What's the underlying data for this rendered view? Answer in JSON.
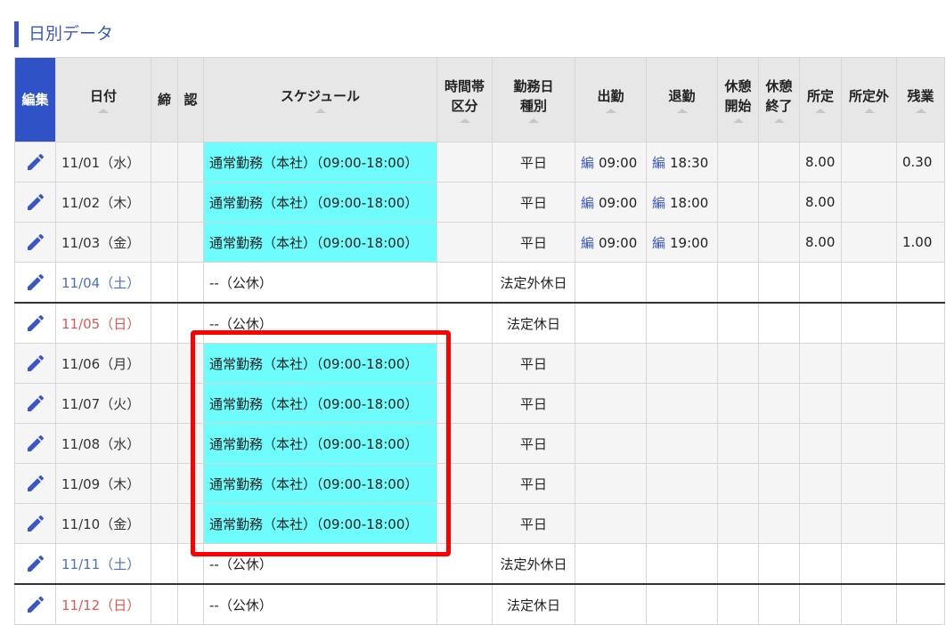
{
  "section_title": "日別データ",
  "headers": {
    "edit": "編集",
    "date": "日付",
    "shime": "締",
    "nin": "認",
    "schedule": "スケジュール",
    "timezone_line1": "時間帯",
    "timezone_line2": "区分",
    "daytype_line1": "勤務日",
    "daytype_line2": "種別",
    "in": "出勤",
    "out": "退勤",
    "break_start_line1": "休憩",
    "break_start_line2": "開始",
    "break_end_line1": "休憩",
    "break_end_line2": "終了",
    "scheduled": "所定",
    "non_scheduled": "所定外",
    "overtime": "残業"
  },
  "hen_label": "編",
  "rows": [
    {
      "date": "11/01（水）",
      "day": "weekday",
      "schedule": "通常勤務（本社）（09:00-18:00）",
      "daytype": "平日",
      "in": "09:00",
      "out": "18:30",
      "scheduled": "8.00",
      "overtime": "0.30"
    },
    {
      "date": "11/02（木）",
      "day": "weekday",
      "schedule": "通常勤務（本社）（09:00-18:00）",
      "daytype": "平日",
      "in": "09:00",
      "out": "18:00",
      "scheduled": "8.00",
      "overtime": ""
    },
    {
      "date": "11/03（金）",
      "day": "weekday",
      "schedule": "通常勤務（本社）（09:00-18:00）",
      "daytype": "平日",
      "in": "09:00",
      "out": "19:00",
      "scheduled": "8.00",
      "overtime": "1.00"
    },
    {
      "date": "11/04（土）",
      "day": "sat",
      "schedule": "--（公休）",
      "daytype": "法定外休日",
      "in": "",
      "out": "",
      "scheduled": "",
      "overtime": ""
    },
    {
      "date": "11/05（日）",
      "day": "sun",
      "schedule": "--（公休）",
      "daytype": "法定休日",
      "in": "",
      "out": "",
      "scheduled": "",
      "overtime": ""
    },
    {
      "date": "11/06（月）",
      "day": "weekday",
      "schedule": "通常勤務（本社）（09:00-18:00）",
      "daytype": "平日",
      "in": "",
      "out": "",
      "scheduled": "",
      "overtime": ""
    },
    {
      "date": "11/07（火）",
      "day": "weekday",
      "schedule": "通常勤務（本社）（09:00-18:00）",
      "daytype": "平日",
      "in": "",
      "out": "",
      "scheduled": "",
      "overtime": ""
    },
    {
      "date": "11/08（水）",
      "day": "weekday",
      "schedule": "通常勤務（本社）（09:00-18:00）",
      "daytype": "平日",
      "in": "",
      "out": "",
      "scheduled": "",
      "overtime": ""
    },
    {
      "date": "11/09（木）",
      "day": "weekday",
      "schedule": "通常勤務（本社）（09:00-18:00）",
      "daytype": "平日",
      "in": "",
      "out": "",
      "scheduled": "",
      "overtime": ""
    },
    {
      "date": "11/10（金）",
      "day": "weekday",
      "schedule": "通常勤務（本社）（09:00-18:00）",
      "daytype": "平日",
      "in": "",
      "out": "",
      "scheduled": "",
      "overtime": ""
    },
    {
      "date": "11/11（土）",
      "day": "sat",
      "schedule": "--（公休）",
      "daytype": "法定外休日",
      "in": "",
      "out": "",
      "scheduled": "",
      "overtime": ""
    },
    {
      "date": "11/12（日）",
      "day": "sun",
      "schedule": "--（公休）",
      "daytype": "法定休日",
      "in": "",
      "out": "",
      "scheduled": "",
      "overtime": ""
    }
  ],
  "colors": {
    "accent": "#3a57c4",
    "work_schedule_bg": "#6ffcfc",
    "saturday": "#4a6fc4",
    "sunday": "#e25555",
    "highlight": "#ff0000"
  },
  "icons": {
    "edit": "pencil-icon",
    "sort": "sort-triangle-icon"
  }
}
